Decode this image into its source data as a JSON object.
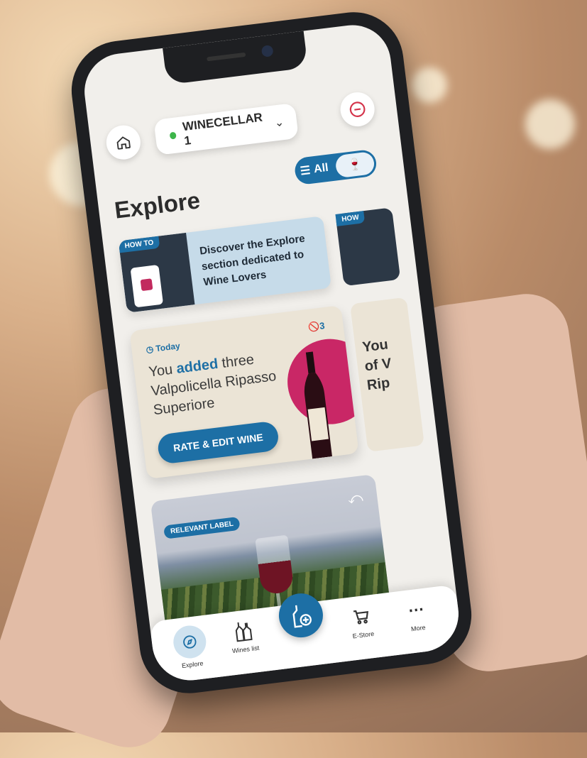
{
  "header": {
    "cellar_name": "WINECELLAR 1"
  },
  "explore": {
    "title": "Explore",
    "filter_all_label": "All"
  },
  "howto_card": {
    "tag": "HOW TO",
    "text": "Discover the Explore section dedicated to Wine Lovers",
    "next_tag": "HOW"
  },
  "activity_card": {
    "when": "Today",
    "count": "3",
    "message_prefix": "You ",
    "message_highlight": "added",
    "message_suffix": " three Valpolicella Ripasso Superiore",
    "cta": "RATE & EDIT WINE",
    "next_text": "You of V Rip"
  },
  "relevant_card": {
    "label": "RELEVANT LABEL"
  },
  "tabbar": {
    "explore": "Explore",
    "wines_list": "Wines list",
    "estore": "E-Store",
    "more": "More"
  },
  "colors": {
    "accent": "#1d6fa5",
    "wine_circle": "#c92766",
    "status_dot": "#3db54a"
  }
}
